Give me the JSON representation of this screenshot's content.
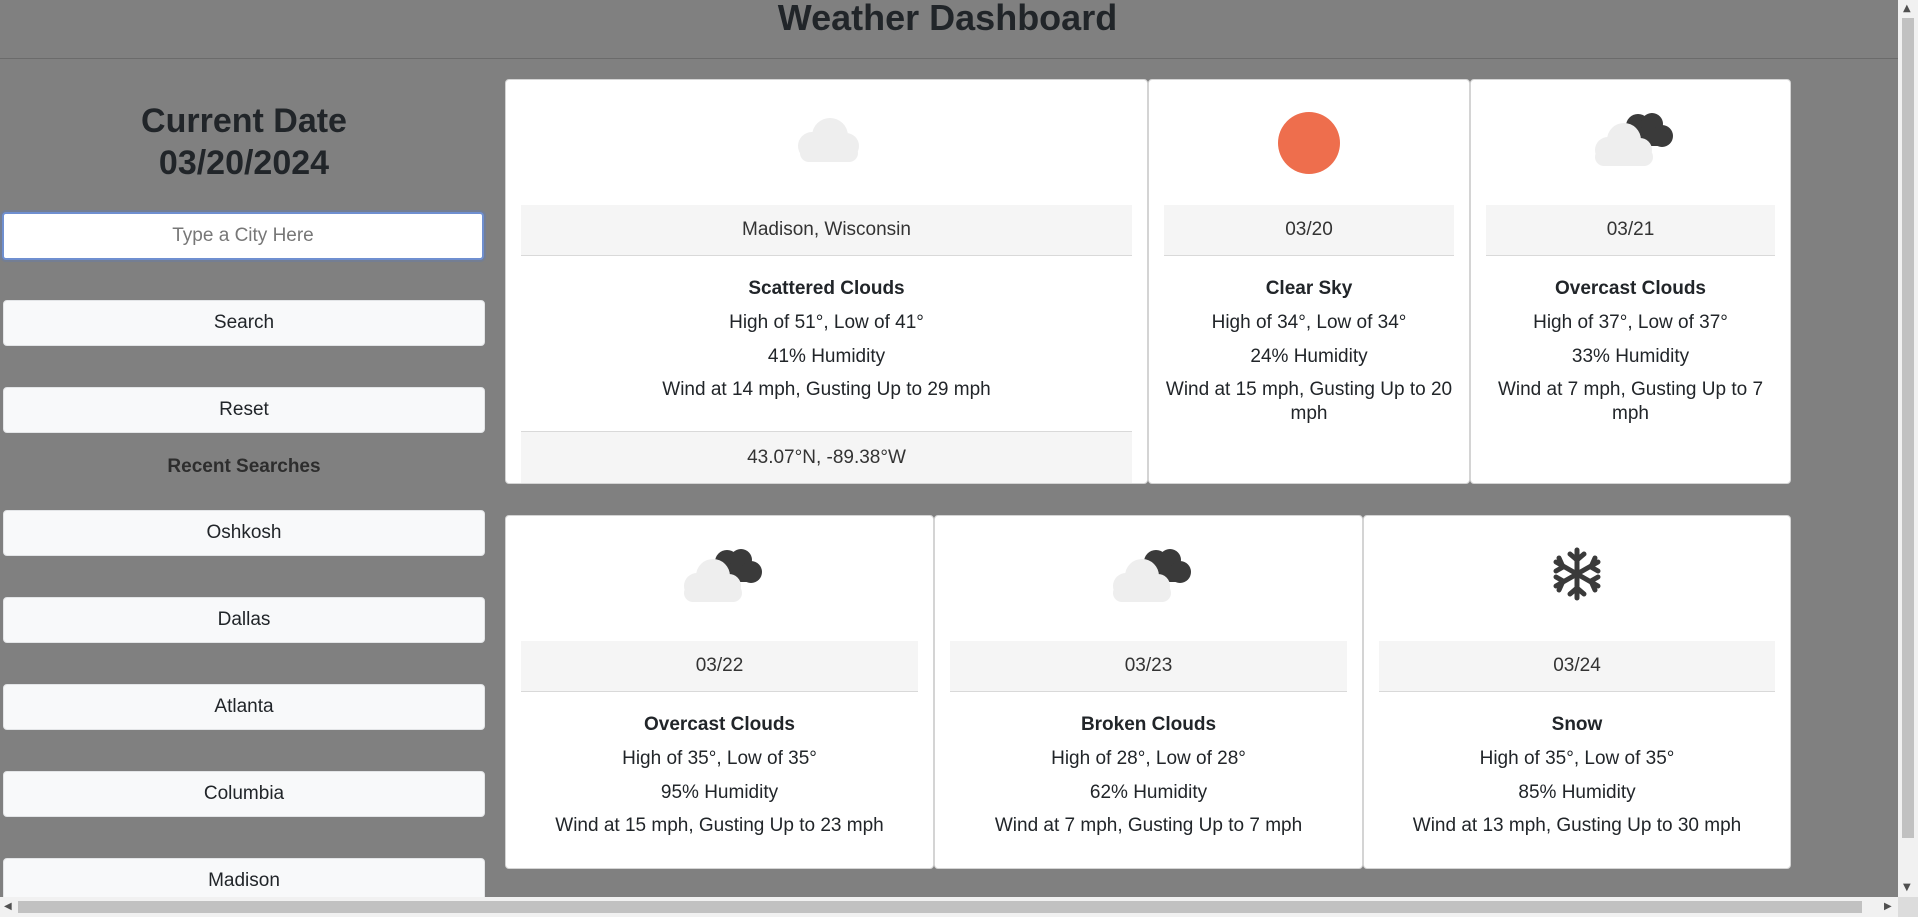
{
  "header": {
    "title": "Weather Dashboard"
  },
  "sidebar": {
    "date_label": "Current Date",
    "date_value": "03/20/2024",
    "search_placeholder": "Type a City Here",
    "search_label": "Search",
    "reset_label": "Reset",
    "recent_title": "Recent Searches",
    "recent": [
      "Oshkosh",
      "Dallas",
      "Atlanta",
      "Columbia",
      "Madison"
    ]
  },
  "current": {
    "icon": "scattered-clouds-icon",
    "location": "Madison, Wisconsin",
    "condition": "Scattered Clouds",
    "temps": "High of 51°, Low of 41°",
    "humidity": "41% Humidity",
    "wind": "Wind at 14 mph, Gusting Up to 29 mph",
    "coords": "43.07°N, -89.38°W"
  },
  "forecast": [
    {
      "icon": "sun-icon",
      "date": "03/20",
      "condition": "Clear Sky",
      "temps": "High of 34°, Low of 34°",
      "humidity": "24% Humidity",
      "wind": "Wind at 15 mph, Gusting Up to 20 mph"
    },
    {
      "icon": "overcast-clouds-icon",
      "date": "03/21",
      "condition": "Overcast Clouds",
      "temps": "High of 37°, Low of 37°",
      "humidity": "33% Humidity",
      "wind": "Wind at 7 mph, Gusting Up to 7 mph"
    },
    {
      "icon": "overcast-clouds-icon",
      "date": "03/22",
      "condition": "Overcast Clouds",
      "temps": "High of 35°, Low of 35°",
      "humidity": "95% Humidity",
      "wind": "Wind at 15 mph, Gusting Up to 23 mph"
    },
    {
      "icon": "broken-clouds-icon",
      "date": "03/23",
      "condition": "Broken Clouds",
      "temps": "High of 28°, Low of 28°",
      "humidity": "62% Humidity",
      "wind": "Wind at 7 mph, Gusting Up to 7 mph"
    },
    {
      "icon": "snowflake-icon",
      "date": "03/24",
      "condition": "Snow",
      "temps": "High of 35°, Low of 35°",
      "humidity": "85% Humidity",
      "wind": "Wind at 13 mph, Gusting Up to 30 mph"
    }
  ],
  "colors": {
    "background": "#808080",
    "sun": "#ee6e4d",
    "cloud_light": "#eeeeee",
    "cloud_dark": "#3a3a3a"
  }
}
